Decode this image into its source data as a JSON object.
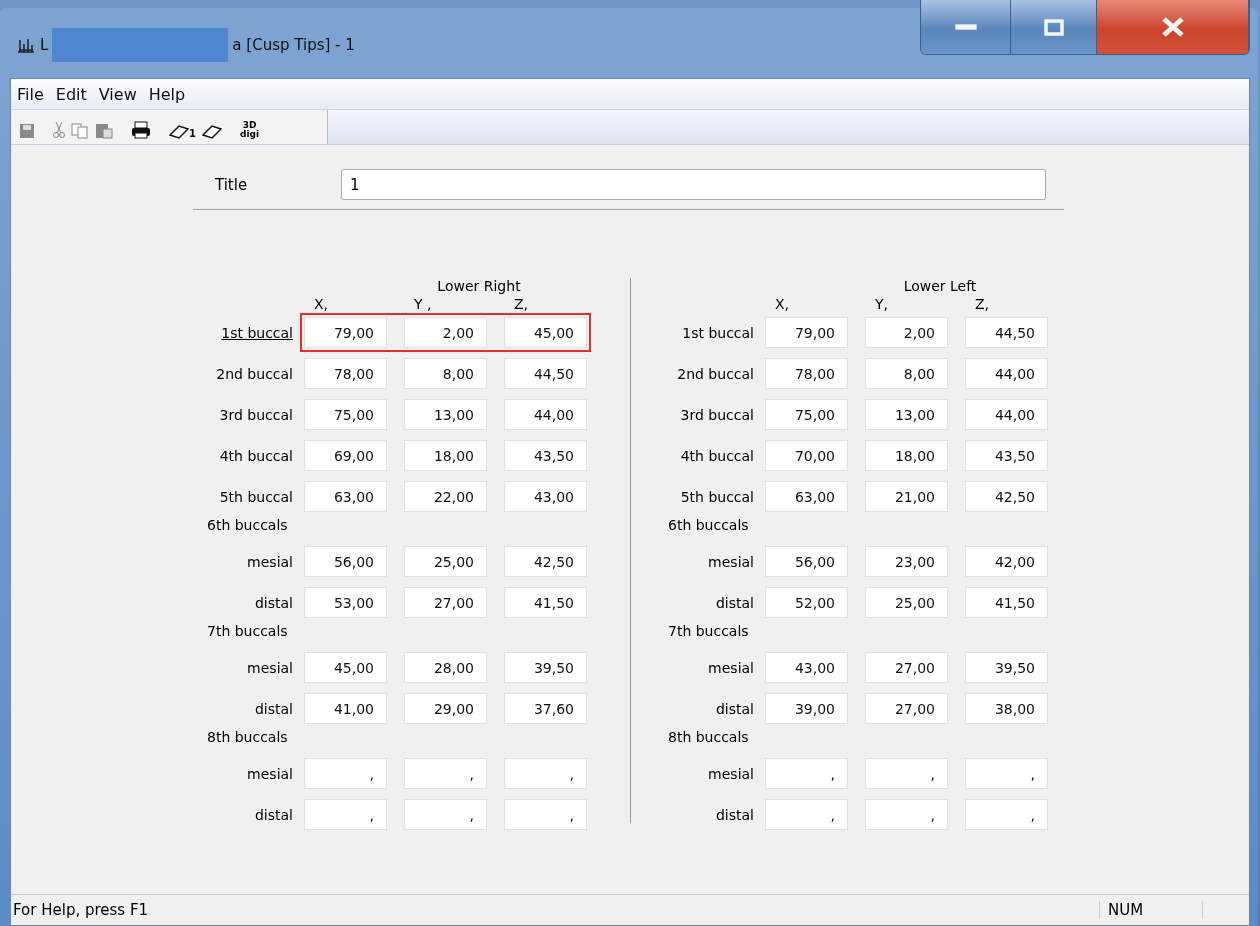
{
  "window": {
    "title_start": "L",
    "title_end": "a [Cusp Tips] - 1"
  },
  "menu": [
    "File",
    "Edit",
    "View",
    "Help"
  ],
  "toolbar": [
    {
      "kind": "save",
      "disabled": true
    },
    {
      "kind": "cut",
      "disabled": true
    },
    {
      "kind": "copy",
      "disabled": true
    },
    {
      "kind": "paste",
      "disabled": true
    },
    {
      "kind": "print",
      "disabled": false
    },
    {
      "kind": "eraser",
      "disabled": false,
      "text": "1"
    },
    {
      "kind": "eraser",
      "disabled": false
    },
    {
      "kind": "digi",
      "disabled": false,
      "text": "3D",
      "subtext": "digi"
    }
  ],
  "title_field": {
    "label": "Title",
    "value": "1"
  },
  "sides": [
    {
      "title": "Lower Right",
      "axes": [
        "X,",
        "Y ,",
        "Z,"
      ],
      "rows": [
        {
          "kind": "values",
          "label": "1st buccal",
          "selected": true,
          "values": [
            "79,00",
            "2,00",
            "45,00"
          ]
        },
        {
          "kind": "values",
          "label": "2nd buccal",
          "selected": false,
          "values": [
            "78,00",
            "8,00",
            "44,50"
          ]
        },
        {
          "kind": "values",
          "label": "3rd buccal",
          "selected": false,
          "values": [
            "75,00",
            "13,00",
            "44,00"
          ]
        },
        {
          "kind": "values",
          "label": "4th buccal",
          "selected": false,
          "values": [
            "69,00",
            "18,00",
            "43,50"
          ]
        },
        {
          "kind": "values",
          "label": "5th buccal",
          "selected": false,
          "values": [
            "63,00",
            "22,00",
            "43,00"
          ]
        },
        {
          "kind": "group",
          "label": "6th buccals"
        },
        {
          "kind": "values",
          "label": "mesial",
          "selected": false,
          "values": [
            "56,00",
            "25,00",
            "42,50"
          ]
        },
        {
          "kind": "values",
          "label": "distal",
          "selected": false,
          "values": [
            "53,00",
            "27,00",
            "41,50"
          ]
        },
        {
          "kind": "group",
          "label": "7th buccals"
        },
        {
          "kind": "values",
          "label": "mesial",
          "selected": false,
          "values": [
            "45,00",
            "28,00",
            "39,50"
          ]
        },
        {
          "kind": "values",
          "label": "distal",
          "selected": false,
          "values": [
            "41,00",
            "29,00",
            "37,60"
          ]
        },
        {
          "kind": "group",
          "label": "8th buccals"
        },
        {
          "kind": "values",
          "label": "mesial",
          "selected": false,
          "values": [
            ",",
            ",",
            ","
          ]
        },
        {
          "kind": "values",
          "label": "distal",
          "selected": false,
          "values": [
            ",",
            ",",
            ","
          ]
        }
      ]
    },
    {
      "title": "Lower Left",
      "axes": [
        "X,",
        "Y,",
        "Z,"
      ],
      "rows": [
        {
          "kind": "values",
          "label": "1st buccal",
          "selected": false,
          "values": [
            "79,00",
            "2,00",
            "44,50"
          ]
        },
        {
          "kind": "values",
          "label": "2nd buccal",
          "selected": false,
          "values": [
            "78,00",
            "8,00",
            "44,00"
          ]
        },
        {
          "kind": "values",
          "label": "3rd buccal",
          "selected": false,
          "values": [
            "75,00",
            "13,00",
            "44,00"
          ]
        },
        {
          "kind": "values",
          "label": "4th buccal",
          "selected": false,
          "values": [
            "70,00",
            "18,00",
            "43,50"
          ]
        },
        {
          "kind": "values",
          "label": "5th buccal",
          "selected": false,
          "values": [
            "63,00",
            "21,00",
            "42,50"
          ]
        },
        {
          "kind": "group",
          "label": "6th buccals"
        },
        {
          "kind": "values",
          "label": "mesial",
          "selected": false,
          "values": [
            "56,00",
            "23,00",
            "42,00"
          ]
        },
        {
          "kind": "values",
          "label": "distal",
          "selected": false,
          "values": [
            "52,00",
            "25,00",
            "41,50"
          ]
        },
        {
          "kind": "group",
          "label": "7th buccals"
        },
        {
          "kind": "values",
          "label": "mesial",
          "selected": false,
          "values": [
            "43,00",
            "27,00",
            "39,50"
          ]
        },
        {
          "kind": "values",
          "label": "distal",
          "selected": false,
          "values": [
            "39,00",
            "27,00",
            "38,00"
          ]
        },
        {
          "kind": "group",
          "label": "8th buccals"
        },
        {
          "kind": "values",
          "label": "mesial",
          "selected": false,
          "values": [
            ",",
            ",",
            ","
          ]
        },
        {
          "kind": "values",
          "label": "distal",
          "selected": false,
          "values": [
            ",",
            ",",
            ","
          ]
        }
      ]
    }
  ],
  "status_bar": {
    "message": "For Help, press F1",
    "indicator": "NUM"
  }
}
